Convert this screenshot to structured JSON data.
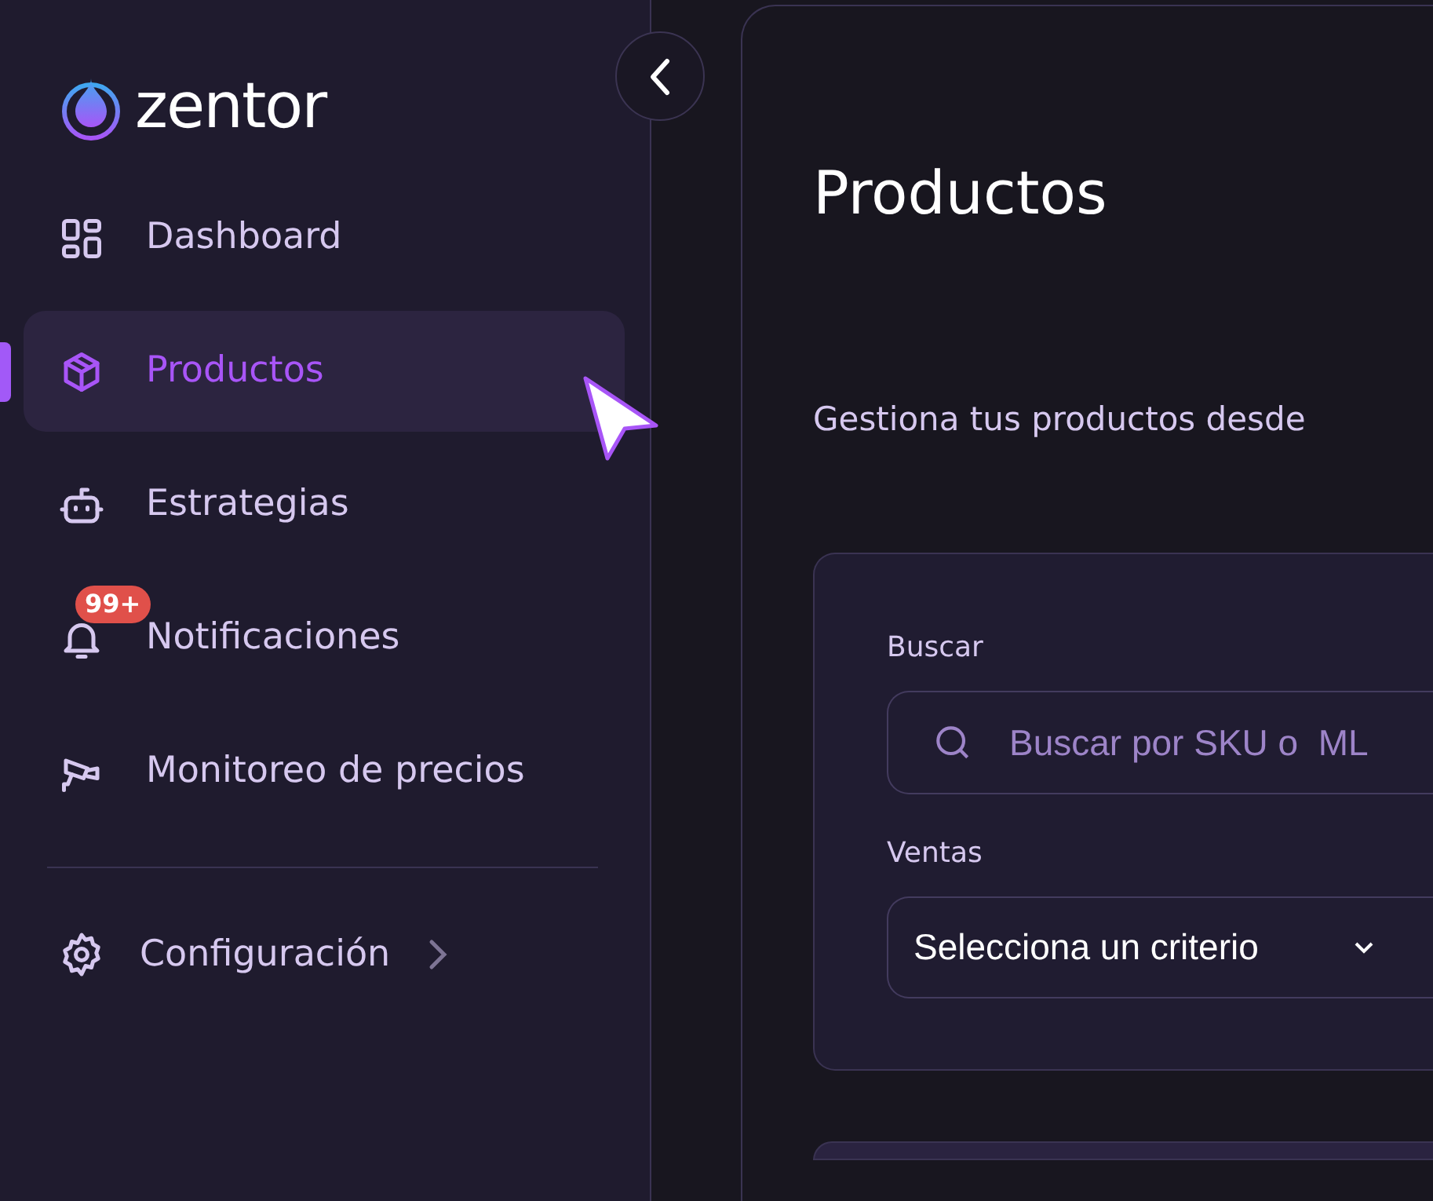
{
  "sidebar": {
    "logo": "zentor",
    "items": [
      {
        "label": "Dashboard",
        "selected": false
      },
      {
        "label": "Productos",
        "selected": true
      },
      {
        "label": "Estrategias",
        "selected": false
      },
      {
        "label": "Notificaciones",
        "selected": false,
        "badge": "99+"
      },
      {
        "label": "Monitoreo de precios",
        "selected": false
      }
    ],
    "settings": {
      "label": "Configuración",
      "expanded": false
    }
  },
  "page": {
    "title": "Productos",
    "subtitle": "Gestiona tus productos desde",
    "filters": {
      "search": {
        "label": "Buscar",
        "placeholder": "Buscar por SKU o  ML"
      },
      "sales": {
        "label": "Ventas",
        "value": "Selecciona un criterio"
      }
    }
  }
}
